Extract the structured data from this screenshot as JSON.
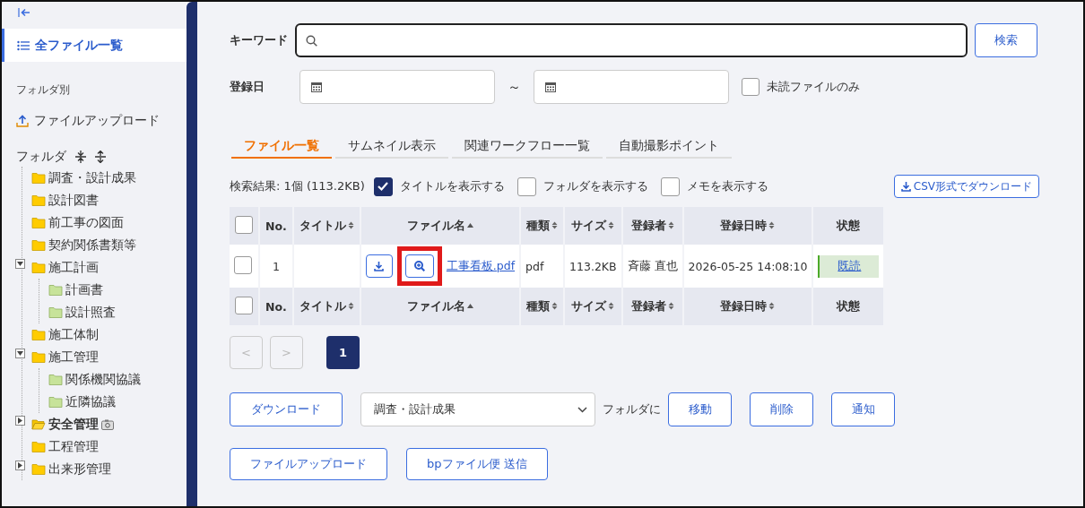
{
  "sidebar": {
    "all_files": {
      "label": "全ファイル一覧",
      "selected": true
    },
    "section_label": "フォルダ別",
    "upload_link": "ファイルアップロード",
    "folder_heading": "フォルダ",
    "tree": [
      {
        "label": "調査・設計成果",
        "selected": false,
        "photo_badge": false
      },
      {
        "label": "設計図書",
        "selected": false,
        "photo_badge": false
      },
      {
        "label": "前工事の図面",
        "selected": false,
        "photo_badge": false
      },
      {
        "label": "契約関係書類等",
        "selected": false,
        "photo_badge": false
      },
      {
        "label": "施工計画",
        "expanded": true,
        "selected": false,
        "photo_badge": false,
        "children": [
          {
            "label": "計画書",
            "selected": false,
            "photo_badge": false
          },
          {
            "label": "設計照査",
            "selected": false,
            "photo_badge": false
          }
        ]
      },
      {
        "label": "施工体制",
        "selected": false,
        "photo_badge": false
      },
      {
        "label": "施工管理",
        "expanded": true,
        "selected": false,
        "photo_badge": false,
        "children": [
          {
            "label": "関係機関協議",
            "selected": false,
            "photo_badge": false
          },
          {
            "label": "近隣協議",
            "selected": false,
            "photo_badge": false
          }
        ]
      },
      {
        "label": "安全管理",
        "expanded": false,
        "selected": true,
        "photo_badge": true
      },
      {
        "label": "工程管理",
        "selected": false,
        "photo_badge": false
      },
      {
        "label": "出来形管理",
        "expanded": false,
        "selected": false,
        "photo_badge": false
      }
    ]
  },
  "search": {
    "keyword_label": "キーワード",
    "search_button": "検索",
    "date_label": "登録日",
    "range_separator": "～",
    "unread_only": {
      "label": "未読ファイルのみ",
      "checked": false
    }
  },
  "tabs": [
    {
      "label": "ファイル一覧",
      "selected": true
    },
    {
      "label": "サムネイル表示",
      "selected": false
    },
    {
      "label": "関連ワークフロー一覧",
      "selected": false
    },
    {
      "label": "自動撮影ポイント",
      "selected": false
    }
  ],
  "results": {
    "summary": "検索結果: 1個 (113.2KB)",
    "options": [
      {
        "label": "タイトルを表示する",
        "checked": true
      },
      {
        "label": "フォルダを表示する",
        "checked": false
      },
      {
        "label": "メモを表示する",
        "checked": false
      }
    ],
    "csv_button": "CSV形式でダウンロード"
  },
  "table": {
    "header_select_all": {
      "checked": false
    },
    "footer_select_all": {
      "checked": false
    },
    "header_columns": [
      {
        "label": "No.",
        "sortable": false
      },
      {
        "label": "タイトル",
        "sortable": true,
        "sorted": false
      },
      {
        "label": "ファイル名",
        "sortable": true,
        "sorted": true
      },
      {
        "label": "種類",
        "sortable": true,
        "sorted": false
      },
      {
        "label": "サイズ",
        "sortable": true,
        "sorted": false
      },
      {
        "label": "登録者",
        "sortable": true,
        "sorted": false
      },
      {
        "label": "登録日時",
        "sortable": true,
        "sorted": false
      },
      {
        "label": "状態",
        "sortable": false
      }
    ],
    "rows": [
      {
        "checked": false,
        "no": "1",
        "title": "",
        "file_name": "工事看板.pdf",
        "type": "pdf",
        "size": "113.2KB",
        "registrant": "斉藤 直也",
        "registered_at": "2026-05-25 14:08:10",
        "status": "既読"
      }
    ],
    "footer_columns": [
      {
        "label": "No.",
        "sortable": false
      },
      {
        "label": "タイトル",
        "sortable": true,
        "sorted": false
      },
      {
        "label": "ファイル名",
        "sortable": true,
        "sorted": true
      },
      {
        "label": "種類",
        "sortable": true,
        "sorted": false
      },
      {
        "label": "サイズ",
        "sortable": true,
        "sorted": false
      },
      {
        "label": "登録者",
        "sortable": true,
        "sorted": false
      },
      {
        "label": "登録日時",
        "sortable": true,
        "sorted": false
      },
      {
        "label": "状態",
        "sortable": false
      }
    ]
  },
  "pagination": {
    "prev": {
      "label": "<",
      "disabled": true
    },
    "next": {
      "label": ">",
      "disabled": true
    },
    "pages": [
      {
        "label": "1",
        "selected": true
      }
    ]
  },
  "actions": {
    "download_button": "ダウンロード",
    "folder_select": "調査・設計成果",
    "folder_suffix": "フォルダに",
    "buttons": [
      "移動",
      "削除",
      "通知"
    ]
  },
  "bottom_buttons": [
    "ファイルアップロード",
    "bpファイル便 送信"
  ]
}
